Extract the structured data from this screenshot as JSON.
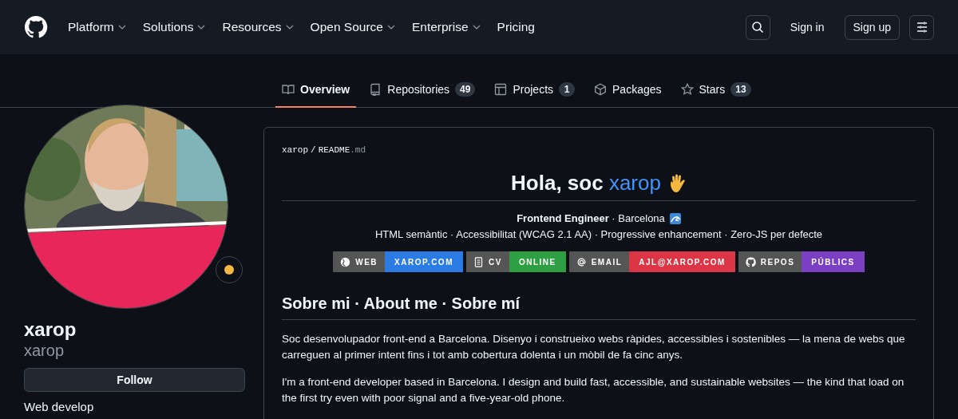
{
  "header": {
    "nav": [
      {
        "label": "Platform",
        "dropdown": true
      },
      {
        "label": "Solutions",
        "dropdown": true
      },
      {
        "label": "Resources",
        "dropdown": true
      },
      {
        "label": "Open Source",
        "dropdown": true
      },
      {
        "label": "Enterprise",
        "dropdown": true
      },
      {
        "label": "Pricing",
        "dropdown": false
      }
    ],
    "sign_in": "Sign in",
    "sign_up": "Sign up"
  },
  "tabs": [
    {
      "label": "Overview",
      "selected": true
    },
    {
      "label": "Repositories",
      "count": "49",
      "selected": false
    },
    {
      "label": "Projects",
      "count": "1",
      "selected": false
    },
    {
      "label": "Packages",
      "selected": false
    },
    {
      "label": "Stars",
      "count": "13",
      "selected": false
    }
  ],
  "profile": {
    "name": "xarop",
    "login": "xarop",
    "follow": "Follow",
    "bio": "Web develop"
  },
  "readme": {
    "path_owner": "xarop",
    "path_sep": "/",
    "path_file": "README",
    "path_ext": ".md",
    "title": "Hola, soc",
    "title_link": "xarop",
    "tagline": "**Frontend Engineer** · Barcelona",
    "skills": "HTML semàntic · Accessibilitat (WCAG 2.1 AA) · Progressive enhancement · Zero-JS per defecte",
    "badges": [
      {
        "label": "WEB",
        "value": "XAROP.COM",
        "color": "#2a7be4"
      },
      {
        "label": "CV",
        "value": "ONLINE",
        "color": "#2ea043"
      },
      {
        "label": "EMAIL",
        "value": "AJL@XAROP.COM",
        "color": "#dc3545"
      },
      {
        "label": "REPOS",
        "value": "PÚBLICS",
        "color": "#7b3fc4"
      }
    ],
    "section_title": "Sobre mi · About me · Sobre mí",
    "paragraphs": [
      "Soc desenvolupador front-end a Barcelona. Disenyo i construeixo webs ràpides, accessibles i sostenibles — la mena de webs que carreguen al primer intent fins i tot amb cobertura dolenta i un mòbil de fa cinc anys.",
      "I'm a front-end developer based in Barcelona. I design and build fast, accessible, and sustainable websites — the kind that load on the first try even with poor signal and a five-year-old phone."
    ]
  }
}
